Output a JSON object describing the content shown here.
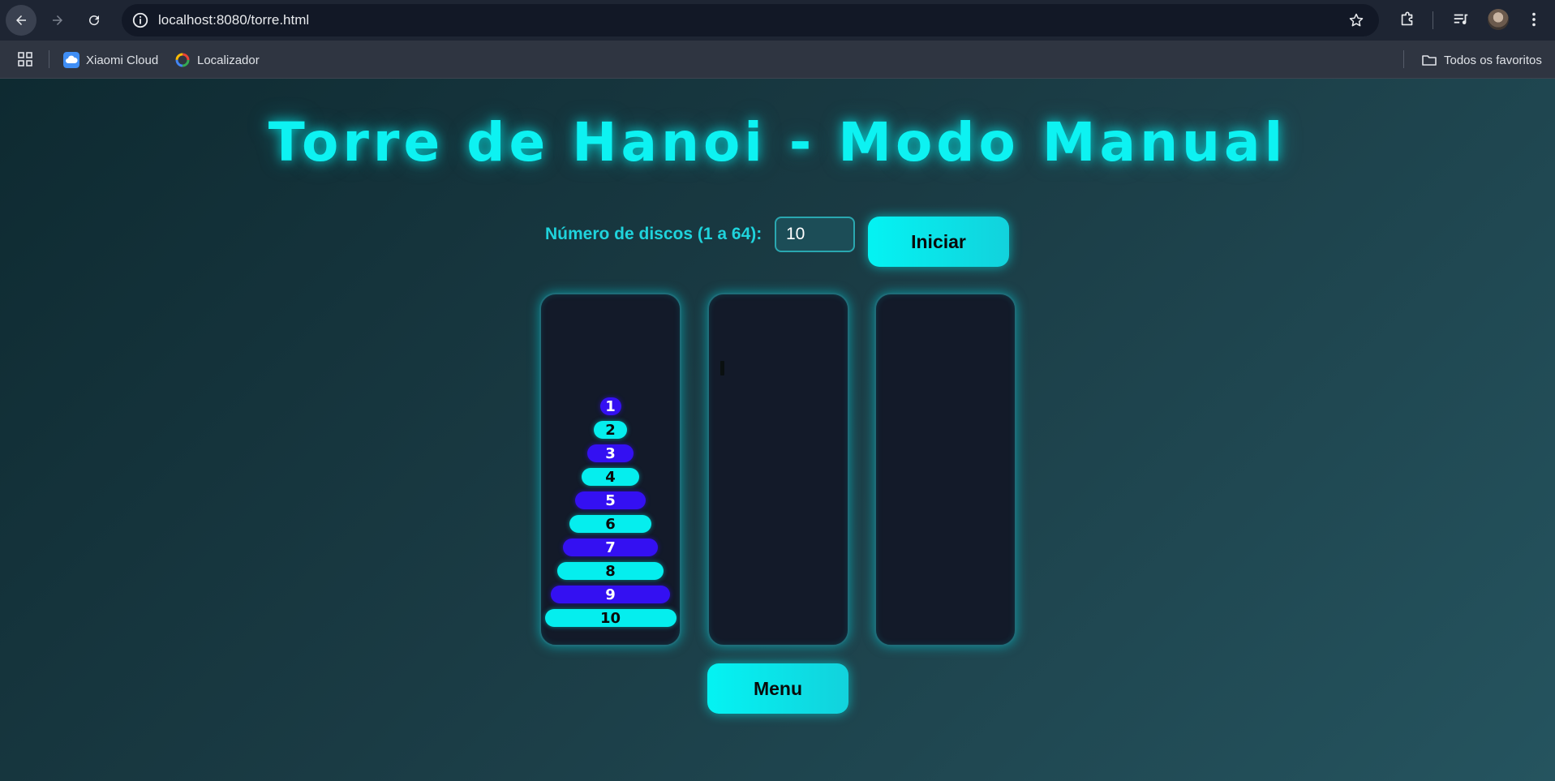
{
  "browser": {
    "url_host": "localhost",
    "url_rest": ":8080/torre.html",
    "bookmarks": [
      {
        "label": "Xiaomi Cloud",
        "icon": "cloud-icon"
      },
      {
        "label": "Localizador",
        "icon": "location-pin-icon"
      }
    ],
    "all_bookmarks_label": "Todos os favoritos"
  },
  "page": {
    "title": "Torre de Hanoi - Modo Manual",
    "discs_label": "Número de discos (1 a 64):",
    "discs_value": "10",
    "start_button": "Iniciar",
    "menu_button": "Menu"
  },
  "towers": [
    {
      "disks": [
        "1",
        "2",
        "3",
        "4",
        "5",
        "6",
        "7",
        "8",
        "9",
        "10"
      ]
    },
    {
      "disks": []
    },
    {
      "disks": []
    }
  ],
  "colors": {
    "accent": "#0df2f2",
    "disk_odd": "#3410f2",
    "disk_even": "#05eeee",
    "tower_bg": "#131a29"
  }
}
